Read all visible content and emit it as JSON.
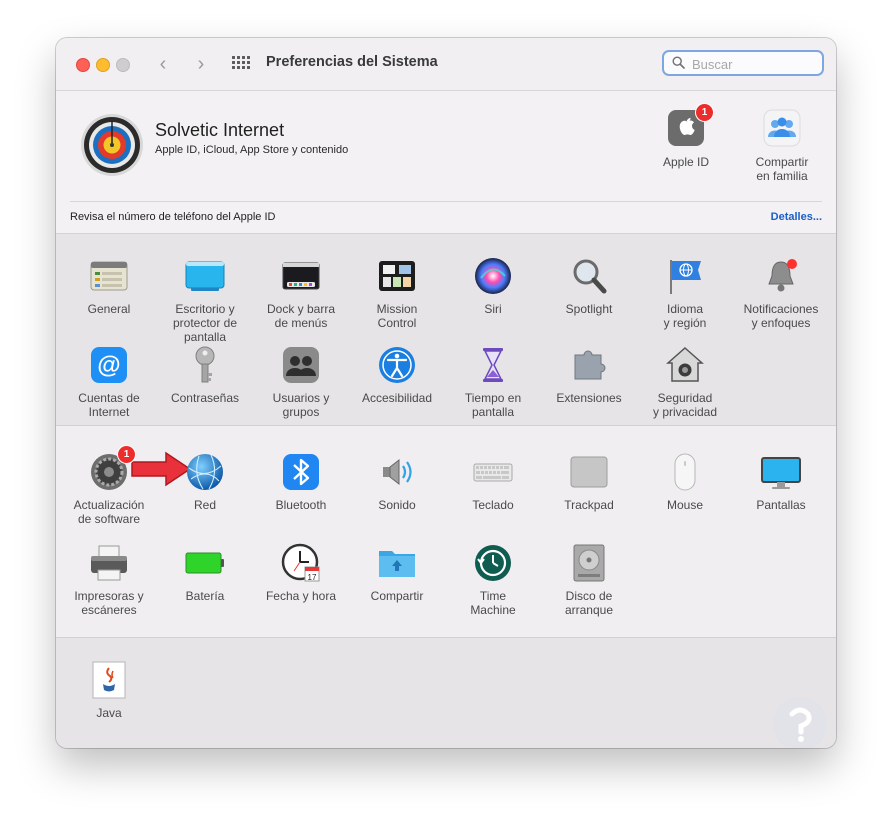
{
  "window": {
    "title": "Preferencias del Sistema"
  },
  "toolbar": {
    "back": "‹",
    "forward": "›"
  },
  "search": {
    "placeholder": "Buscar",
    "value": ""
  },
  "account": {
    "name": "Solvetic Internet",
    "subtitle": "Apple ID, iCloud, App Store y contenido",
    "items": [
      {
        "label": "Apple ID",
        "icon": "apple-icon",
        "badge": "1"
      },
      {
        "label": "Compartir\nen familia",
        "icon": "family-icon"
      }
    ],
    "notice": "Revisa el número de teléfono del Apple ID",
    "details_link": "Detalles..."
  },
  "panes_row1": [
    {
      "label": "General",
      "icon": "general-icon"
    },
    {
      "label": "Escritorio y\nprotector de pantalla",
      "icon": "desktop-icon"
    },
    {
      "label": "Dock y barra\nde menús",
      "icon": "dock-icon"
    },
    {
      "label": "Mission\nControl",
      "icon": "mission-control-icon"
    },
    {
      "label": "Siri",
      "icon": "siri-icon"
    },
    {
      "label": "Spotlight",
      "icon": "spotlight-icon"
    },
    {
      "label": "Idioma\ny región",
      "icon": "globe-flag-icon"
    },
    {
      "label": "Notificaciones\ny enfoques",
      "icon": "bell-icon"
    }
  ],
  "panes_row2": [
    {
      "label": "Cuentas de\nInternet",
      "icon": "at-icon"
    },
    {
      "label": "Contraseñas",
      "icon": "key-icon"
    },
    {
      "label": "Usuarios y\ngrupos",
      "icon": "users-icon"
    },
    {
      "label": "Accesibilidad",
      "icon": "accessibility-icon"
    },
    {
      "label": "Tiempo en\npantalla",
      "icon": "hourglass-icon"
    },
    {
      "label": "Extensiones",
      "icon": "puzzle-icon"
    },
    {
      "label": "Seguridad\ny privacidad",
      "icon": "house-lock-icon"
    }
  ],
  "panes_row3": [
    {
      "label": "Actualización\nde software",
      "icon": "gear-icon",
      "badge": "1"
    },
    {
      "label": "Red",
      "icon": "network-globe-icon"
    },
    {
      "label": "Bluetooth",
      "icon": "bluetooth-icon"
    },
    {
      "label": "Sonido",
      "icon": "speaker-icon"
    },
    {
      "label": "Teclado",
      "icon": "keyboard-icon"
    },
    {
      "label": "Trackpad",
      "icon": "trackpad-icon"
    },
    {
      "label": "Mouse",
      "icon": "mouse-icon"
    },
    {
      "label": "Pantallas",
      "icon": "display-icon"
    }
  ],
  "panes_row4": [
    {
      "label": "Impresoras y\nescáneres",
      "icon": "printer-icon"
    },
    {
      "label": "Batería",
      "icon": "battery-icon"
    },
    {
      "label": "Fecha y hora",
      "icon": "clock-icon"
    },
    {
      "label": "Compartir",
      "icon": "folder-share-icon"
    },
    {
      "label": "Time\nMachine",
      "icon": "time-machine-icon"
    },
    {
      "label": "Disco de\narranque",
      "icon": "disk-icon"
    }
  ],
  "panes_row5": [
    {
      "label": "Java",
      "icon": "java-icon"
    }
  ],
  "colors": {
    "accent": "#1a5fc8",
    "badge": "#ef2c2c",
    "annotation_arrow": "#e8313a"
  }
}
